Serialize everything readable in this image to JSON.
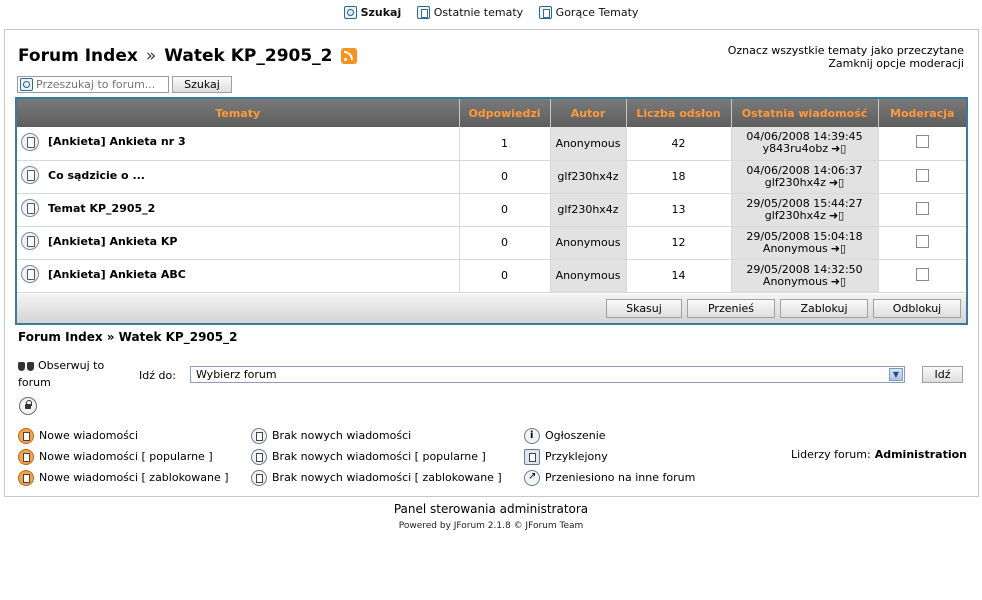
{
  "topnav": {
    "search": "Szukaj",
    "recent": "Ostatnie tematy",
    "hot": "Gorące Tematy"
  },
  "header": {
    "forum_index": "Forum Index",
    "separator": "»",
    "forum_name": "Watek KP_2905_2"
  },
  "actions": {
    "mark_read": "Oznacz wszystkie tematy jako przeczytane",
    "close_moderation": "Zamknij opcje moderacji"
  },
  "search": {
    "placeholder": "Przeszukaj to forum...",
    "button": "Szukaj"
  },
  "table": {
    "headers": [
      "Tematy",
      "Odpowiedzi",
      "Autor",
      "Liczba odsłon",
      "Ostatnia wiadomość",
      "Moderacja"
    ],
    "rows": [
      {
        "title": "[Ankieta] Ankieta nr 3",
        "replies": "1",
        "author": "Anonymous",
        "views": "42",
        "last_date": "04/06/2008 14:39:45",
        "last_user": "y843ru4obz"
      },
      {
        "title": "Co sądzicie o ...",
        "replies": "0",
        "author": "glf230hx4z",
        "views": "18",
        "last_date": "04/06/2008 14:06:37",
        "last_user": "glf230hx4z"
      },
      {
        "title": "Temat KP_2905_2",
        "replies": "0",
        "author": "glf230hx4z",
        "views": "13",
        "last_date": "29/05/2008 15:44:27",
        "last_user": "glf230hx4z"
      },
      {
        "title": "[Ankieta] Ankieta KP",
        "replies": "0",
        "author": "Anonymous",
        "views": "12",
        "last_date": "29/05/2008 15:04:18",
        "last_user": "Anonymous"
      },
      {
        "title": "[Ankieta] Ankieta ABC",
        "replies": "0",
        "author": "Anonymous",
        "views": "14",
        "last_date": "29/05/2008 14:32:50",
        "last_user": "Anonymous"
      }
    ]
  },
  "moderation": {
    "delete": "Skasuj",
    "move": "Przenieś",
    "lock": "Zablokuj",
    "unlock": "Odblokuj"
  },
  "breadcrumb": "Forum Index » Watek KP_2905_2",
  "watch": "Obserwuj to forum",
  "jump": {
    "label": "Idź do:",
    "selected": "Wybierz forum",
    "button": "Idź"
  },
  "legend": {
    "new": "Nowe wiadomości",
    "new_popular": "Nowe wiadomości [ popularne ]",
    "new_locked": "Nowe wiadomości [ zablokowane ]",
    "none": "Brak nowych wiadomości",
    "none_popular": "Brak nowych wiadomości [ popularne ]",
    "none_locked": "Brak nowych wiadomości [ zablokowane ]",
    "announce": "Ogłoszenie",
    "sticky": "Przyklejony",
    "moved": "Przeniesiono na inne forum"
  },
  "leaders": {
    "label": "Liderzy forum:",
    "value": "Administration"
  },
  "footer": {
    "admin_panel": "Panel sterowania administratora",
    "powered": "Powered by JForum 2.1.8 © JForum Team"
  }
}
